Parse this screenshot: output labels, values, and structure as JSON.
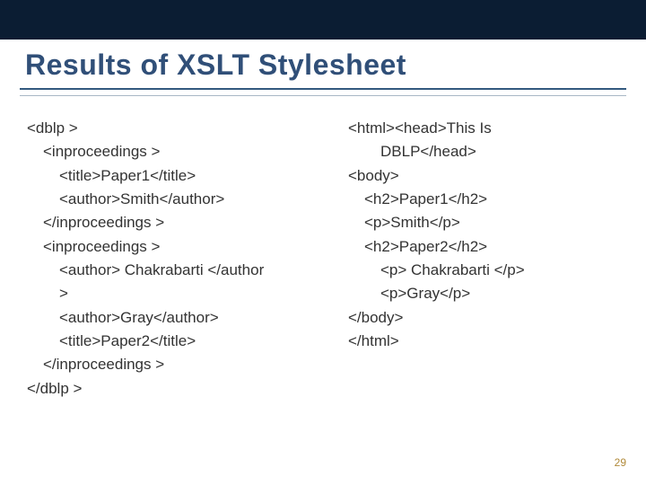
{
  "title": "Results of XSLT Stylesheet",
  "left": {
    "l0": "<dblp >",
    "l1": "<inproceedings  >",
    "l2": "<title>Paper1</title>",
    "l3": "<author>Smith</author>",
    "l4": "</inproceedings  >",
    "l5": "<inproceedings  >",
    "l6": "<author> Chakrabarti   </author",
    "l7": ">",
    "l8": "<author>Gray</author>",
    "l9": "<title>Paper2</title>",
    "l10": "</inproceedings  >",
    "l11": "</dblp >"
  },
  "right": {
    "r0": "<html><head>This Is",
    "r1": "DBLP</head>",
    "r2": "<body>",
    "r3": "<h2>Paper1</h2>",
    "r4": "<p>Smith</p>",
    "r5": "<h2>Paper2</h2>",
    "r6": "<p> Chakrabarti   </p>",
    "r7": "<p>Gray</p>",
    "r8": "</body>",
    "r9": "</html>"
  },
  "page_number": "29"
}
